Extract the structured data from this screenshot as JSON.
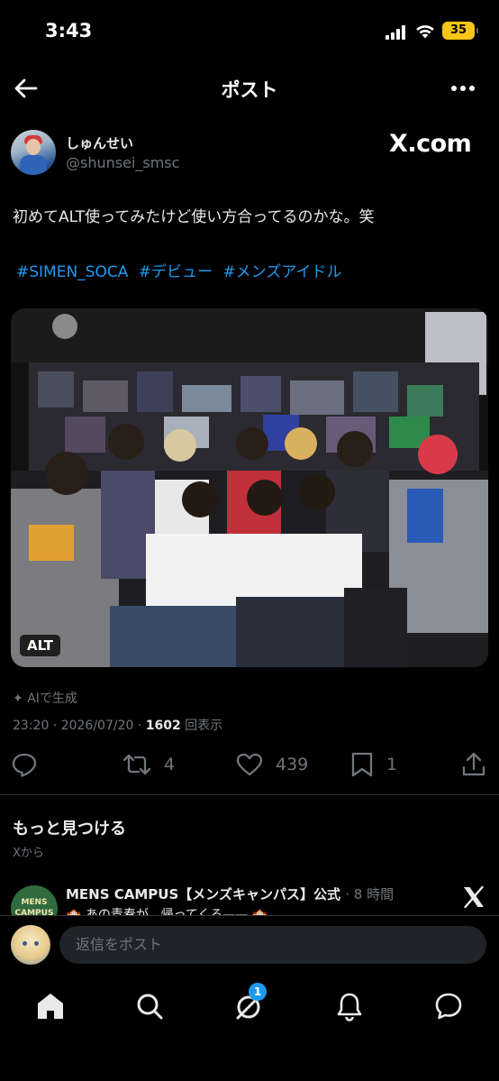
{
  "status_bar": {
    "time": "3:43",
    "battery": "35"
  },
  "header": {
    "title": "ポスト"
  },
  "author": {
    "name": "しゅんせい",
    "handle": "@shunsei_smsc",
    "watermark": "X.com"
  },
  "post": {
    "text": "初めてALT使ってみたけど使い方合ってるのかな。笑",
    "hashtags": [
      "#SIMEN_SOCA",
      "#デビュー",
      "#メンズアイドル"
    ],
    "media_alt_badge": "ALT",
    "ai_label": "AIで生成",
    "timestamp": "23:20 · 2026/07/20 · ",
    "views_count": "1602",
    "views_label": "回表示"
  },
  "actions": {
    "retweets": "4",
    "likes": "439",
    "bookmarks": "1"
  },
  "discover": {
    "title": "もっと見つける",
    "subtitle": "Xから",
    "recommendation": {
      "avatar_text": "MENS CAMPUS",
      "name": "MENS CAMPUS【メンズキャンパス】公式",
      "time": "· 8 時間",
      "text": "🏫 あの青春が、帰ってくる—— 🏫"
    }
  },
  "reply": {
    "placeholder": "返信をポスト"
  },
  "tabbar": {
    "messages_badge": "1"
  },
  "colors": {
    "accent": "#1d9bf0",
    "background": "#000000",
    "muted": "#71767b",
    "text": "#e7e9ea"
  }
}
